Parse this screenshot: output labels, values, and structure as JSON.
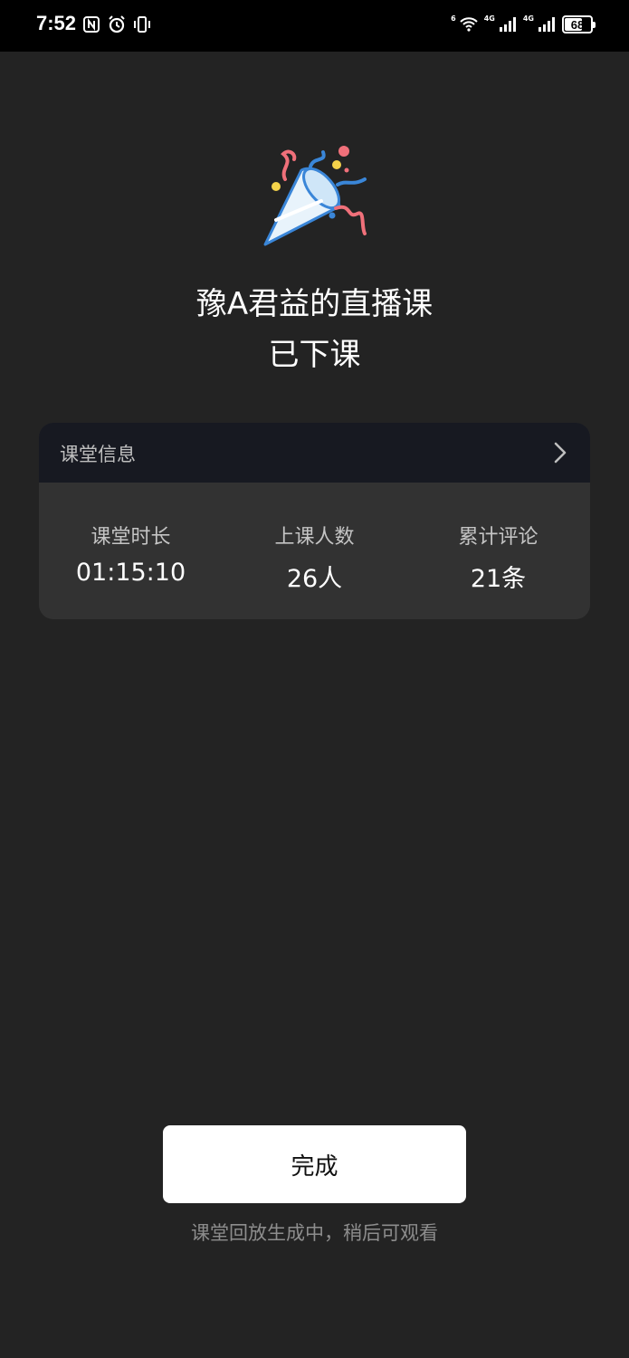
{
  "status_bar": {
    "time": "7:52",
    "signal_1_label": "4G",
    "signal_2_label": "4G",
    "wifi_label": "6",
    "battery": "68",
    "battery_level": 0.68
  },
  "hero": {
    "icon": "party-popper-icon",
    "title_line1": "豫A君益的直播课",
    "title_line2": "已下课"
  },
  "info_card": {
    "header_label": "课堂信息",
    "stats": [
      {
        "label": "课堂时长",
        "value": "01:15:10"
      },
      {
        "label": "上课人数",
        "value": "26人"
      },
      {
        "label": "累计评论",
        "value": "21条"
      }
    ]
  },
  "footer": {
    "done_label": "完成",
    "note": "课堂回放生成中，稍后可观看"
  },
  "colors": {
    "background": "#232323",
    "card": "#323232",
    "card_header": "#171921",
    "button": "#ffffff"
  }
}
